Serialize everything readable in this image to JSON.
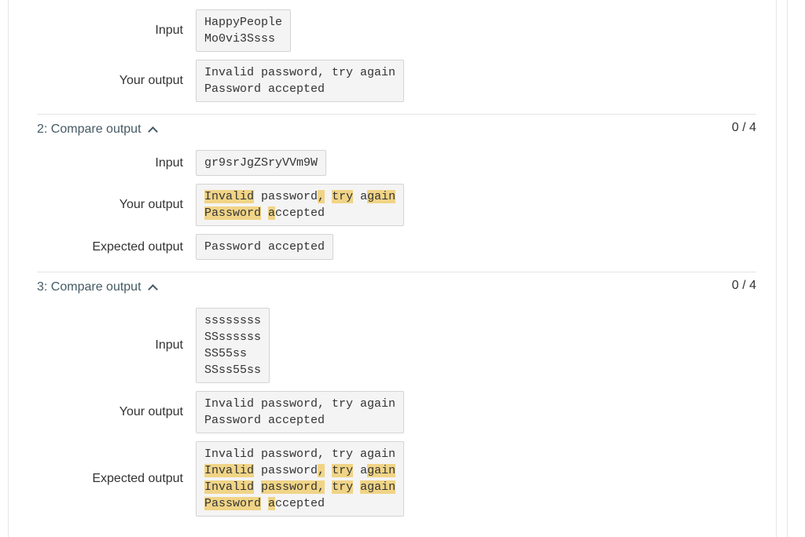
{
  "test1": {
    "input_label": "Input",
    "input": [
      "HappyPeople",
      "Mo0vi3Ssss"
    ],
    "output_label": "Your output",
    "output": [
      [
        {
          "t": "Invalid password, try again",
          "h": false
        }
      ],
      [
        {
          "t": "Password accepted",
          "h": false
        }
      ]
    ]
  },
  "test2": {
    "title": "2: Compare output",
    "score": "0 / 4",
    "input_label": "Input",
    "input": [
      "gr9srJgZSryVVm9W"
    ],
    "output_label": "Your output",
    "output": [
      [
        {
          "t": "Invalid",
          "h": true
        },
        {
          "t": " password",
          "h": false
        },
        {
          "t": ",",
          "h": true
        },
        {
          "t": " ",
          "h": false
        },
        {
          "t": "try",
          "h": true
        },
        {
          "t": " a",
          "h": false
        },
        {
          "t": "gain",
          "h": true
        }
      ],
      [
        {
          "t": "Password",
          "h": true
        },
        {
          "t": " ",
          "h": false
        },
        {
          "t": "a",
          "h": true
        },
        {
          "t": "ccepted",
          "h": false
        }
      ]
    ],
    "expected_label": "Expected output",
    "expected": [
      [
        {
          "t": "Password accepted",
          "h": false
        }
      ]
    ]
  },
  "test3": {
    "title": "3: Compare output",
    "score": "0 / 4",
    "input_label": "Input",
    "input": [
      "ssssssss",
      "SSssssss",
      "SS55ss",
      "SSss55ss"
    ],
    "output_label": "Your output",
    "output": [
      [
        {
          "t": "Invalid password, try again",
          "h": false
        }
      ],
      [
        {
          "t": "Password accepted",
          "h": false
        }
      ]
    ],
    "expected_label": "Expected output",
    "expected": [
      [
        {
          "t": "Invalid password, try again",
          "h": false
        }
      ],
      [
        {
          "t": "Invalid",
          "h": true
        },
        {
          "t": " password",
          "h": false
        },
        {
          "t": ",",
          "h": true
        },
        {
          "t": " ",
          "h": false
        },
        {
          "t": "try",
          "h": true
        },
        {
          "t": " a",
          "h": false
        },
        {
          "t": "gain",
          "h": true
        }
      ],
      [
        {
          "t": "Invalid",
          "h": true
        },
        {
          "t": " ",
          "h": false
        },
        {
          "t": "password,",
          "h": true
        },
        {
          "t": " ",
          "h": false
        },
        {
          "t": "try",
          "h": true
        },
        {
          "t": " ",
          "h": false
        },
        {
          "t": "again",
          "h": true
        }
      ],
      [
        {
          "t": "Password",
          "h": true
        },
        {
          "t": " ",
          "h": false
        },
        {
          "t": "a",
          "h": true
        },
        {
          "t": "ccepted",
          "h": false
        }
      ]
    ]
  },
  "colors": {
    "highlight": "#f0d486",
    "header_text": "#455a64",
    "box_bg": "#f4f4f4"
  }
}
